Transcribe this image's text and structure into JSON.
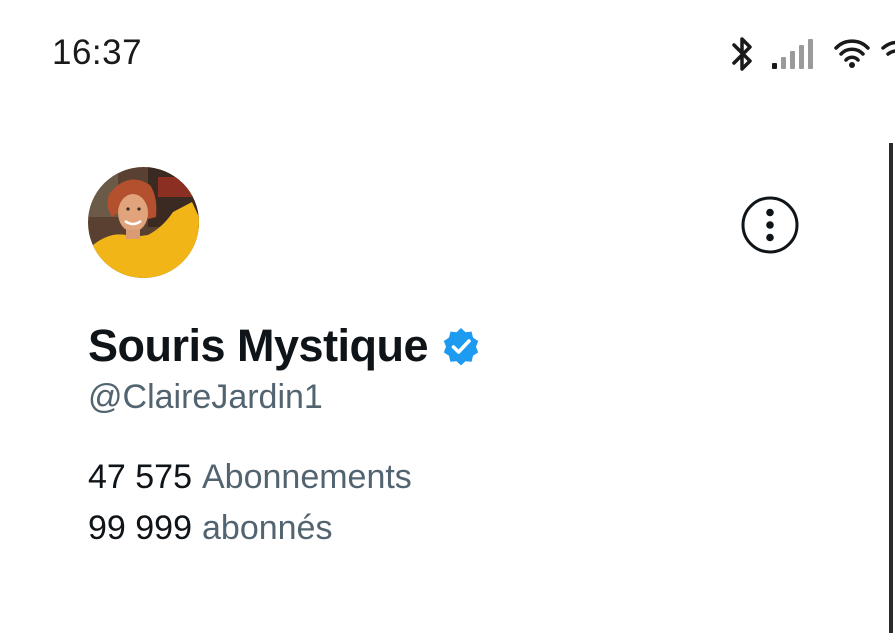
{
  "status_bar": {
    "time": "16:37",
    "icons": [
      "bluetooth-icon",
      "signal-icon",
      "wifi-icon"
    ]
  },
  "profile": {
    "display_name": "Souris Mystique",
    "verified": true,
    "handle": "@ClaireJardin1",
    "avatar": "avatar-photo",
    "menu_icon": "more-options-icon"
  },
  "stats": {
    "following_count": "47 575",
    "following_label": "Abonnements",
    "followers_count": "99 999",
    "followers_label": "abonnés"
  },
  "colors": {
    "verified_badge": "#1d9bf0",
    "text_primary": "#0f1419",
    "text_secondary": "#536471"
  }
}
